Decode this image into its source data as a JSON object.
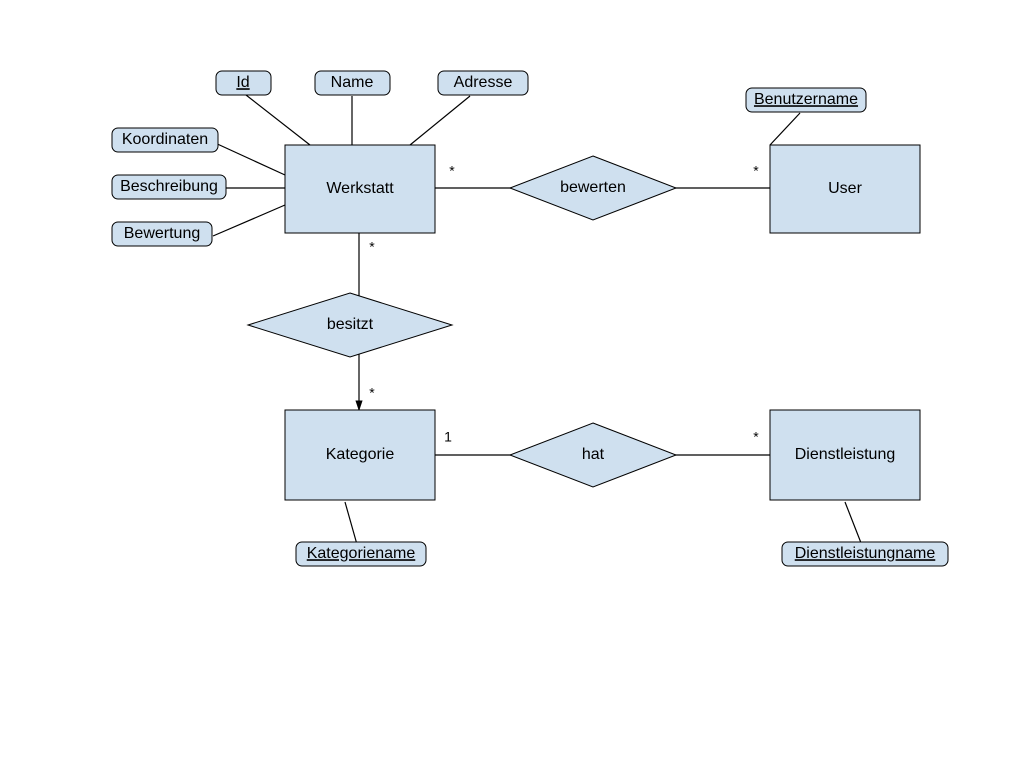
{
  "entities": {
    "werkstatt": "Werkstatt",
    "user": "User",
    "kategorie": "Kategorie",
    "dienstleistung": "Dienstleistung"
  },
  "relationships": {
    "bewerten": "bewerten",
    "besitzt": "besitzt",
    "hat": "hat"
  },
  "attributes": {
    "id": "Id",
    "name": "Name",
    "adresse": "Adresse",
    "koordinaten": "Koordinaten",
    "beschreibung": "Beschreibung",
    "bewertung": "Bewertung",
    "benutzername": "Benutzername",
    "kategoriename": "Kategoriename",
    "dienstleistungname": "Dienstleistungname"
  },
  "cardinalities": {
    "werkstatt_bewerten": "*",
    "user_bewerten": "*",
    "werkstatt_besitzt": "*",
    "kategorie_besitzt": "*",
    "kategorie_hat": "1",
    "dienstleistung_hat": "*"
  }
}
